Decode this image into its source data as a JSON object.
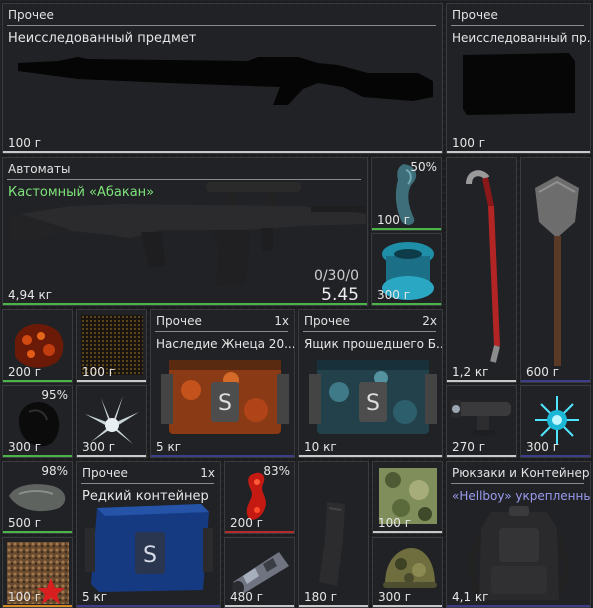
{
  "items": {
    "unknown_rifle": {
      "category": "Прочее",
      "name": "Неисследованный предмет",
      "weight": "100 г"
    },
    "unknown_box": {
      "category": "Прочее",
      "name": "Неисследованный пр...",
      "weight": "100 г"
    },
    "abakan": {
      "category": "Автоматы",
      "name": "Кастомный «Абакан»",
      "weight": "4,94 кг",
      "ammo": "0/30/0",
      "caliber": "5.45"
    },
    "blue_bone": {
      "percent": "50%",
      "weight": "100 г"
    },
    "blue_coil": {
      "weight": "300 г"
    },
    "crowbar": {
      "weight": "1,2 кг"
    },
    "shovel": {
      "weight": "600 г"
    },
    "orange_crystal": {
      "weight": "200 г"
    },
    "dark_tile": {
      "weight": "100 г"
    },
    "reaper_case": {
      "category": "Прочее",
      "count": "1x",
      "name": "Наследие Жнеца 20...",
      "weight": "5 кг"
    },
    "past_box": {
      "category": "Прочее",
      "count": "2x",
      "name": "Ящик прошедшего Б...",
      "weight": "10 кг"
    },
    "black_feather": {
      "percent": "95%",
      "weight": "300 г"
    },
    "white_crystal": {
      "weight": "300 г"
    },
    "scope": {
      "weight": "270 г"
    },
    "cyan_spark": {
      "weight": "300 г"
    },
    "gray_rock": {
      "percent": "98%",
      "weight": "500 г"
    },
    "rare_container": {
      "category": "Прочее",
      "count": "1x",
      "name": "Редкий контейнер",
      "weight": "5 кг"
    },
    "red_flower": {
      "percent": "83%",
      "weight": "200 г"
    },
    "magazine": {
      "weight": "180 г"
    },
    "camo_patch": {
      "weight": "100 г"
    },
    "backpack": {
      "category": "Рюкзаки и Контейнеры",
      "name": "«Hellboy» укрепленны...",
      "weight": "4,1 кг"
    },
    "red_star_tile": {
      "weight": "100 г"
    },
    "tube": {
      "weight": "480 г"
    },
    "camo_helmet": {
      "weight": "300 г"
    }
  }
}
